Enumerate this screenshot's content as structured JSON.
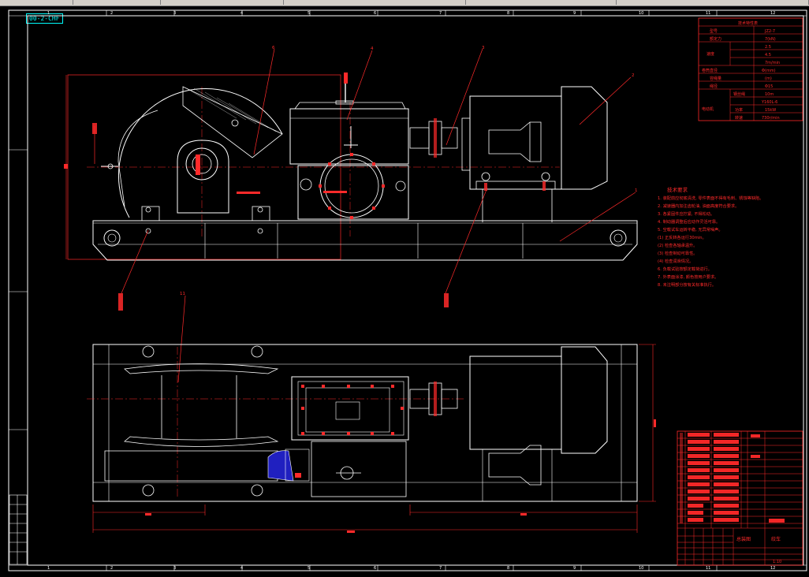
{
  "app": {
    "toolbar_icon": "drawing-tab-icon",
    "tab_label": "00-2-CHF"
  },
  "colors": {
    "background": "#000000",
    "frame": "#ffffff",
    "dimension": "#ff2a2a",
    "center_line": "#ff2a2a",
    "label": "#00ffff",
    "hatch": "#2020c0"
  },
  "border": {
    "top_numbers": [
      "1",
      "2",
      "3",
      "4",
      "5",
      "6",
      "7",
      "8",
      "9",
      "10",
      "11",
      "12"
    ],
    "bottom_numbers": [
      "1",
      "2",
      "3",
      "4",
      "5",
      "6",
      "7",
      "8",
      "9",
      "10",
      "11",
      "12"
    ]
  },
  "balloons": {
    "b1": "1",
    "b2": "2",
    "b3": "3",
    "b4": "4",
    "b6": "6",
    "b11": "11"
  },
  "spec_table": {
    "title": "技术特性表",
    "rows": [
      [
        "型号",
        "JZ2-7"
      ],
      [
        "额定力",
        "7(kN)"
      ],
      [
        "速度",
        "2.5"
      ],
      [
        "",
        "4.5"
      ],
      [
        "",
        "7m/min"
      ],
      [
        "卷筒直径",
        "Φ(mm)"
      ],
      [
        "容绳量",
        "(m)"
      ],
      [
        "绳径",
        "Φ15"
      ],
      [
        "钢丝绳",
        "10m"
      ],
      [
        "电动机",
        "Y160L-6"
      ],
      [
        "功率",
        "15kW"
      ],
      [
        "转速",
        "730r/min"
      ]
    ]
  },
  "tech_req": {
    "title": "技术要求",
    "lines": [
      "1. 装配前应彻底清洗, 零件表面不得有毛刺、锈蚀等缺陷。",
      "2. 减速器内加注齿轮油, 油面高度符合要求。",
      "3. 各紧固件应拧紧, 不得松动。",
      "4. 制动器调整后应动作灵活可靠。",
      "5. 空载试车运转平稳, 无异常噪声。",
      "   (1) 正反转各运行30min。",
      "   (2) 检查各轴承温升。",
      "   (3) 检查制动可靠性。",
      "   (4) 检查润滑情况。",
      "6. 负载试验按额定载荷进行。",
      "7. 外表面涂漆, 颜色按用户要求。",
      "8. 未注明部分按有关标准执行。"
    ]
  },
  "title_block": {
    "name": "总装图",
    "drawing_title": "绞车",
    "scale": "1:10"
  },
  "revision_table": {
    "rows": [
      "",
      "",
      "",
      "",
      "",
      ""
    ]
  }
}
